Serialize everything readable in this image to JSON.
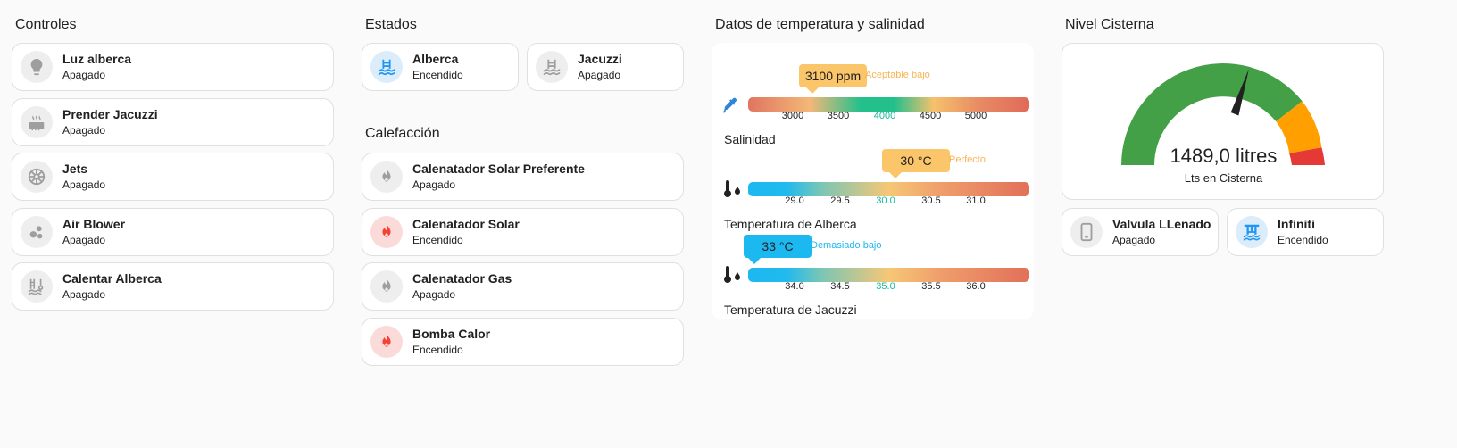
{
  "controles": {
    "title": "Controles",
    "items": [
      {
        "name": "Luz alberca",
        "state": "Apagado",
        "icon": "lightbulb-icon"
      },
      {
        "name": "Prender Jacuzzi",
        "state": "Apagado",
        "icon": "heater-icon"
      },
      {
        "name": "Jets",
        "state": "Apagado",
        "icon": "fan-icon"
      },
      {
        "name": "Air Blower",
        "state": "Apagado",
        "icon": "bubbles-icon"
      },
      {
        "name": "Calentar Alberca",
        "state": "Apagado",
        "icon": "pool-thermometer-icon"
      }
    ]
  },
  "estados": {
    "title": "Estados",
    "items": [
      {
        "name": "Alberca",
        "state": "Encendido",
        "icon": "pool-icon"
      },
      {
        "name": "Jacuzzi",
        "state": "Apagado",
        "icon": "pool-icon"
      }
    ]
  },
  "calefaccion": {
    "title": "Calefacción",
    "items": [
      {
        "name": "Calenatador Solar Preferente",
        "state": "Apagado",
        "icon": "fire-icon"
      },
      {
        "name": "Calenatador Solar",
        "state": "Encendido",
        "icon": "fire-icon"
      },
      {
        "name": "Calenatador Gas",
        "state": "Apagado",
        "icon": "fire-icon"
      },
      {
        "name": "Bomba Calor",
        "state": "Encendido",
        "icon": "fire-icon"
      }
    ]
  },
  "datos": {
    "title": "Datos de temperatura y salinidad",
    "salinidad": {
      "value_label": "3100 ppm",
      "status": "Aceptable bajo",
      "label": "Salinidad",
      "ticks": [
        "3000",
        "3500",
        "4000",
        "4500",
        "5000"
      ],
      "value": 3100
    },
    "temp_alberca": {
      "value_label": "30 °C",
      "status": "Perfecto",
      "label": "Temperatura de Alberca",
      "ticks": [
        "29.0",
        "29.5",
        "30.0",
        "30.5",
        "31.0"
      ],
      "value": 30
    },
    "temp_jacuzzi": {
      "value_label": "33 °C",
      "status": "Demasiado bajo",
      "label": "Temperatura de Jacuzzi",
      "ticks": [
        "34.0",
        "34.5",
        "35.0",
        "35.5",
        "36.0"
      ],
      "value": 33
    }
  },
  "cisterna": {
    "title": "Nivel Cisterna",
    "gauge_value": "1489,0 litres",
    "gauge_label": "Lts en Cisterna",
    "level": 1489.0,
    "items": [
      {
        "name": "Valvula LLenado",
        "state": "Apagado",
        "icon": "valve-icon"
      },
      {
        "name": "Infiniti",
        "state": "Encendido",
        "icon": "water-pump-icon"
      }
    ]
  },
  "colors": {
    "on_blue": "#2196f3",
    "on_red": "#f44336",
    "off_grey": "#9e9e9e",
    "gauge_green": "#43a047",
    "gauge_orange": "#ffa000",
    "gauge_red": "#e53935"
  }
}
